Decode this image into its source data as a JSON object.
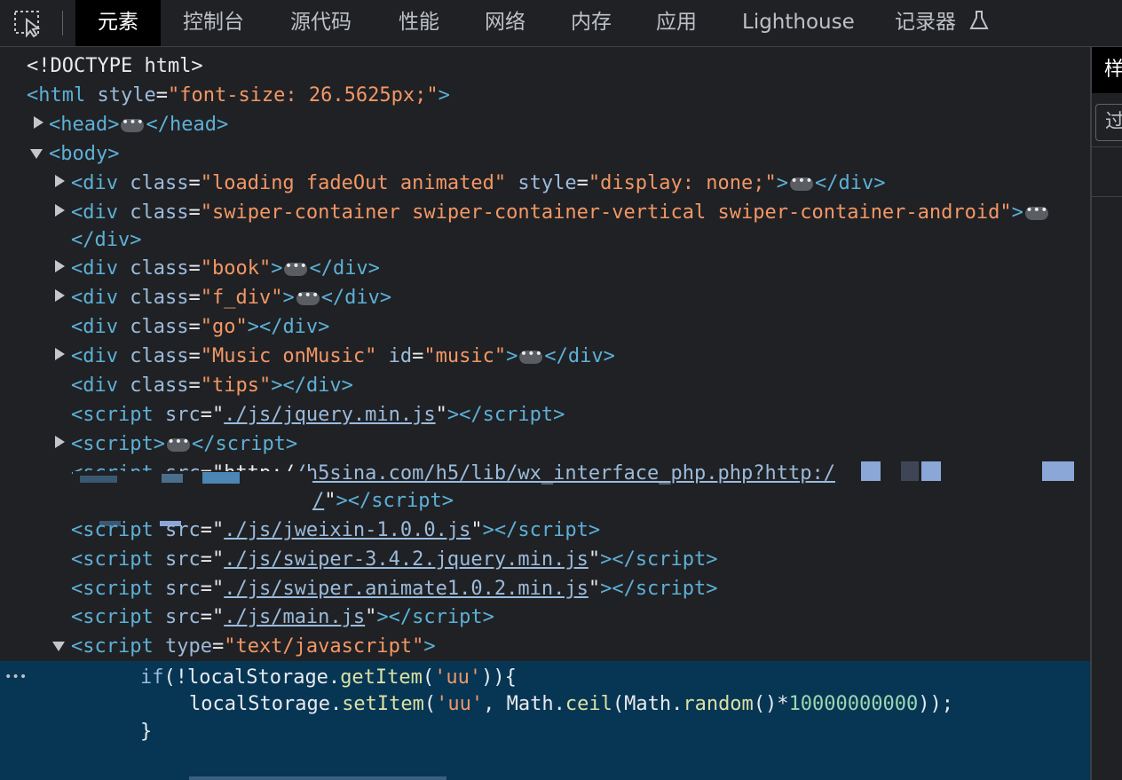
{
  "toolbar": {
    "tabs": [
      "元素",
      "控制台",
      "源代码",
      "性能",
      "网络",
      "内存",
      "应用",
      "Lighthouse",
      "记录器"
    ]
  },
  "tree": {
    "doctype": "<!DOCTYPE html>",
    "html_open": "<html",
    "html_attr": "style",
    "html_value": "\"font-size: 26.5625px;\"",
    "head_open": "<head>",
    "head_close": "</head>",
    "body_open": "<body>",
    "div_loading_value": "\"loading fadeOut animated\"",
    "div_loading_style_value": "\"display: none;\"",
    "div_swiper_value": "\"swiper-container swiper-container-vertical swiper-container-android\"",
    "div_book_value": "\"book\"",
    "div_fdiv_value": "\"f_div\"",
    "div_go_value": "\"go\"",
    "div_music_value": "\"Music onMusic\"",
    "div_music_id": "\"music\"",
    "div_tips_value": "\"tips\"",
    "script1_src": "./js/jquery.min.js",
    "script_weixin_src": "/h5sina.com/h5/lib/wx_interface_php.php?http:/",
    "script_weixin_src_end": "/",
    "script_jweixin_src": "./js/jweixin-1.0.0.js",
    "script_swiper_src": "./js/swiper-3.4.2.jquery.min.js",
    "script_animate_src": "./js/swiper.animate1.0.2.min.js",
    "script_main_src": "./js/main.js",
    "script_type_value": "\"text/javascript\"",
    "ellipsis": "•••",
    "code": {
      "line1_kw": "if",
      "line1_a": "(!localStorage.",
      "line1_fn": "getItem",
      "line1_str": "'uu'",
      "line1_b": ")){",
      "line2_a": "localStorage.",
      "line2_fn": "setItem",
      "line2_str": "'uu'",
      "line2_b": ", Math.",
      "line2_fn2": "ceil",
      "line2_c": "(Math.",
      "line2_fn3": "random",
      "line2_d": "()*",
      "line2_num": "10000000000",
      "line2_e": "));",
      "line3": "}"
    }
  },
  "sidebar": {
    "tab_label": "样",
    "filter_label": "过"
  }
}
